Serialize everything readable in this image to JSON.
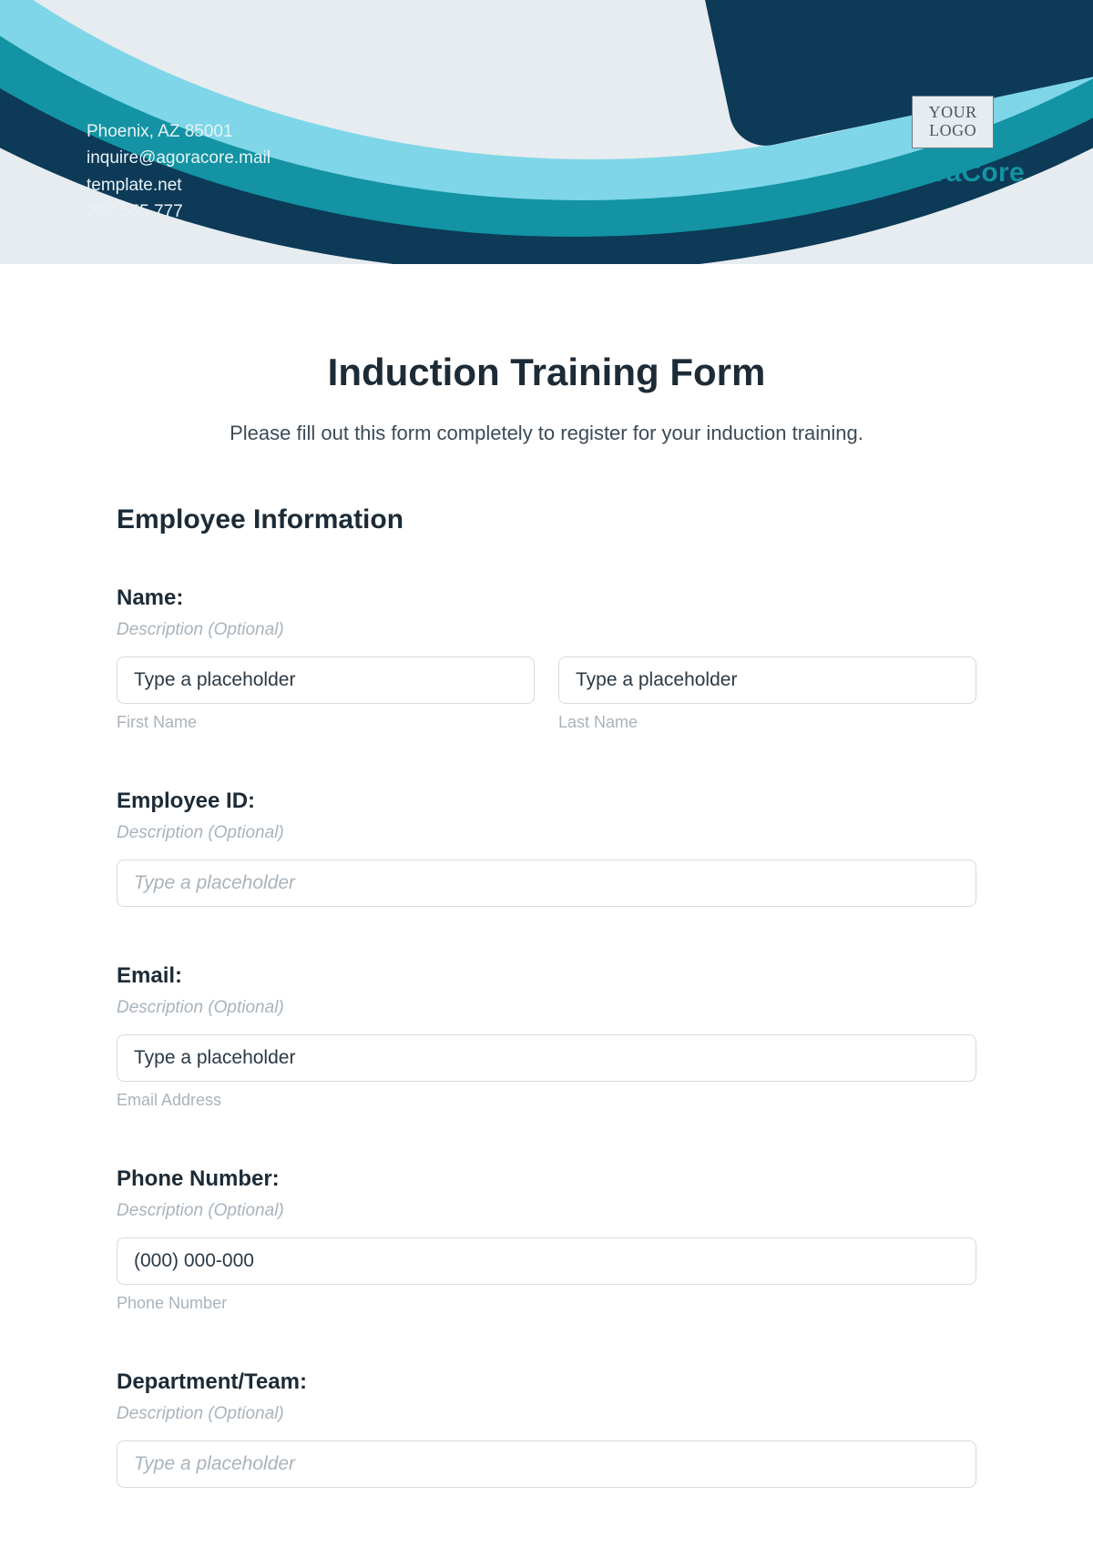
{
  "header": {
    "contact": {
      "address": "Phoenix, AZ 85001",
      "email": "inquire@agoracore.mail",
      "website": "template.net",
      "phone": "222 555 777"
    },
    "logo_lines": [
      "YOUR",
      "LOGO"
    ],
    "brand": "AgoraCore"
  },
  "form": {
    "title": "Induction Training Form",
    "subtitle": "Please fill out this form completely to register for your induction training.",
    "section_heading": "Employee Information",
    "fields": {
      "name": {
        "label": "Name:",
        "desc": "Description (Optional)",
        "first_placeholder": "Type a placeholder",
        "first_sublabel": "First Name",
        "last_placeholder": "Type a placeholder",
        "last_sublabel": "Last Name"
      },
      "employee_id": {
        "label": "Employee ID:",
        "desc": "Description (Optional)",
        "placeholder": "Type a placeholder"
      },
      "email": {
        "label": "Email:",
        "desc": "Description (Optional)",
        "placeholder": "Type a placeholder",
        "sublabel": "Email Address"
      },
      "phone": {
        "label": "Phone Number:",
        "desc": "Description (Optional)",
        "placeholder": "(000) 000-000",
        "sublabel": "Phone Number"
      },
      "department": {
        "label": "Department/Team:",
        "desc": "Description (Optional)",
        "placeholder": "Type a placeholder"
      }
    }
  }
}
